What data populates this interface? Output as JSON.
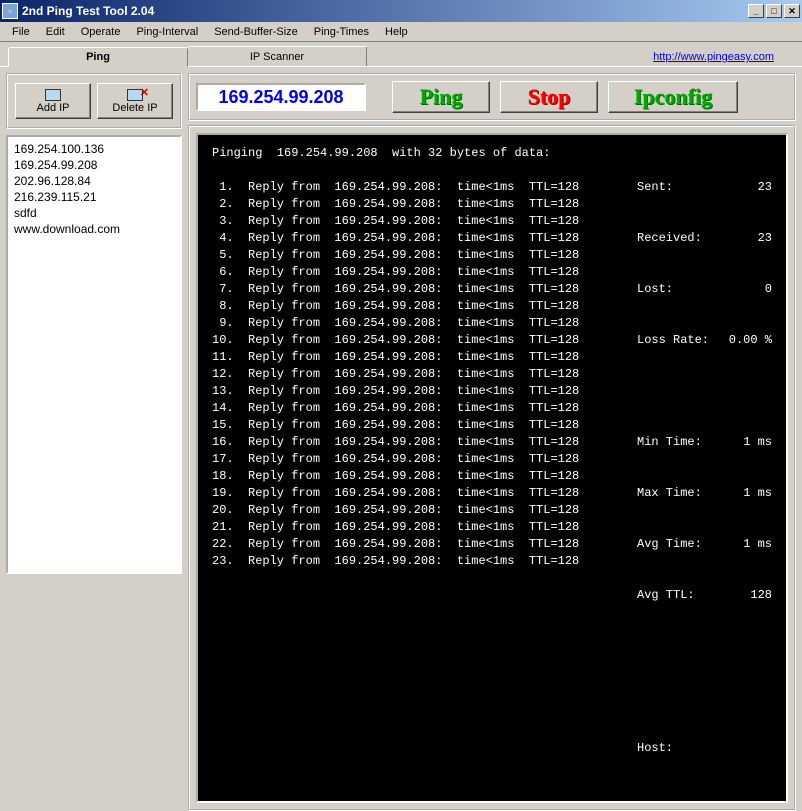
{
  "window": {
    "title": "2nd Ping Test Tool 2.04"
  },
  "menu": {
    "items": [
      "File",
      "Edit",
      "Operate",
      "Ping-Interval",
      "Send-Buffer-Size",
      "Ping-Times",
      "Help"
    ]
  },
  "tabs": {
    "ping": "Ping",
    "ipscanner": "IP Scanner"
  },
  "link": {
    "url": "http://www.pingeasy.com"
  },
  "left": {
    "add_ip": "Add IP",
    "delete_ip": "Delete IP",
    "ips": [
      "169.254.100.136",
      "169.254.99.208",
      "202.96.128.84",
      "216.239.115.21",
      "sdfd",
      "www.download.com"
    ]
  },
  "actions": {
    "ip_value": "169.254.99.208",
    "ping": "Ping",
    "stop": "Stop",
    "ipconfig": "Ipconfig"
  },
  "terminal": {
    "header": "Pinging  169.254.99.208  with 32 bytes of data:",
    "lines": [
      " 1.  Reply from  169.254.99.208:  time<1ms  TTL=128",
      " 2.  Reply from  169.254.99.208:  time<1ms  TTL=128",
      " 3.  Reply from  169.254.99.208:  time<1ms  TTL=128",
      " 4.  Reply from  169.254.99.208:  time<1ms  TTL=128",
      " 5.  Reply from  169.254.99.208:  time<1ms  TTL=128",
      " 6.  Reply from  169.254.99.208:  time<1ms  TTL=128",
      " 7.  Reply from  169.254.99.208:  time<1ms  TTL=128",
      " 8.  Reply from  169.254.99.208:  time<1ms  TTL=128",
      " 9.  Reply from  169.254.99.208:  time<1ms  TTL=128",
      "10.  Reply from  169.254.99.208:  time<1ms  TTL=128",
      "11.  Reply from  169.254.99.208:  time<1ms  TTL=128",
      "12.  Reply from  169.254.99.208:  time<1ms  TTL=128",
      "13.  Reply from  169.254.99.208:  time<1ms  TTL=128",
      "14.  Reply from  169.254.99.208:  time<1ms  TTL=128",
      "15.  Reply from  169.254.99.208:  time<1ms  TTL=128",
      "16.  Reply from  169.254.99.208:  time<1ms  TTL=128",
      "17.  Reply from  169.254.99.208:  time<1ms  TTL=128",
      "18.  Reply from  169.254.99.208:  time<1ms  TTL=128",
      "19.  Reply from  169.254.99.208:  time<1ms  TTL=128",
      "20.  Reply from  169.254.99.208:  time<1ms  TTL=128",
      "21.  Reply from  169.254.99.208:  time<1ms  TTL=128",
      "22.  Reply from  169.254.99.208:  time<1ms  TTL=128",
      "23.  Reply from  169.254.99.208:  time<1ms  TTL=128"
    ],
    "stats": {
      "sent_label": "Sent:",
      "sent": "23",
      "received_label": "Received:",
      "received": "23",
      "lost_label": "Lost:",
      "lost": "0",
      "lossrate_label": "Loss Rate:",
      "lossrate": "0.00 %",
      "min_label": "Min Time:",
      "min": "1 ms",
      "max_label": "Max Time:",
      "max": "1 ms",
      "avg_label": "Avg Time:",
      "avg": "1 ms",
      "avgttl_label": "Avg TTL:",
      "avgttl": "128",
      "host_label": "Host:",
      "host": ""
    }
  }
}
